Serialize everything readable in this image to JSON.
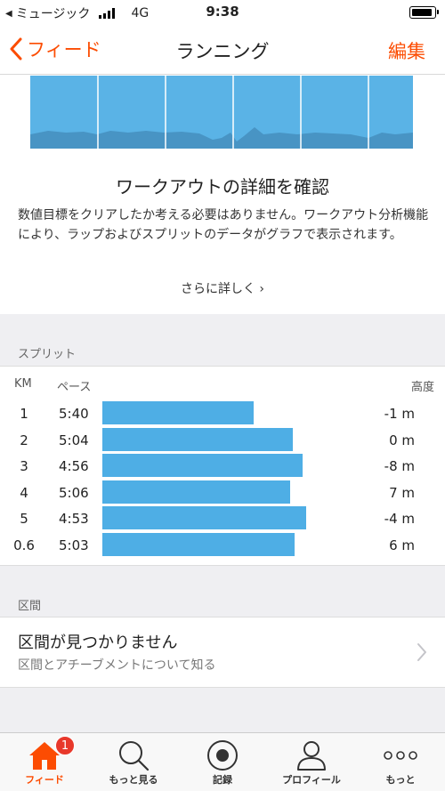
{
  "status_bar": {
    "back_app": "ミュージック",
    "network": "4G",
    "time": "9:38"
  },
  "nav": {
    "back_label": "フィード",
    "title": "ランニング",
    "edit_label": "編集"
  },
  "preview": {
    "title": "ワークアウトの詳細を確認",
    "description": "数値目標をクリアしたか考える必要はありません。ワークアウト分析機能により、ラップおよびスプリットのデータがグラフで表示されます。",
    "more_link": "さらに詳しく ›",
    "color": "#5ab3e6"
  },
  "splits": {
    "section_label": "スプリット",
    "headers": {
      "km": "KM",
      "pace": "ペース",
      "elevation": "高度"
    },
    "chart_data": {
      "type": "bar",
      "categories": [
        "1",
        "2",
        "3",
        "4",
        "5",
        "0.6"
      ],
      "pace_labels": [
        "5:40",
        "5:04",
        "4:56",
        "5:06",
        "4:53",
        "5:03"
      ],
      "values": [
        0.77,
        0.97,
        1.02,
        0.96,
        1.04,
        0.98
      ],
      "elevation_labels": [
        "-1 m",
        "0 m",
        "-8 m",
        "7 m",
        "-4 m",
        "6 m"
      ],
      "bar_color": "#4eaee5"
    }
  },
  "segments": {
    "section_label": "区間",
    "title": "区間が見つかりません",
    "subtitle": "区間とアチーブメントについて知る"
  },
  "tabbar": {
    "items": [
      {
        "label": "フィード",
        "icon": "home-icon",
        "active": true,
        "badge": "1"
      },
      {
        "label": "もっと見る",
        "icon": "search-icon",
        "active": false
      },
      {
        "label": "記録",
        "icon": "record-icon",
        "active": false
      },
      {
        "label": "プロフィール",
        "icon": "profile-icon",
        "active": false
      },
      {
        "label": "もっと",
        "icon": "more-icon",
        "active": false
      }
    ]
  },
  "colors": {
    "accent": "#fc4c02",
    "chart_blue": "#4eaee5",
    "badge": "#e8382b"
  }
}
